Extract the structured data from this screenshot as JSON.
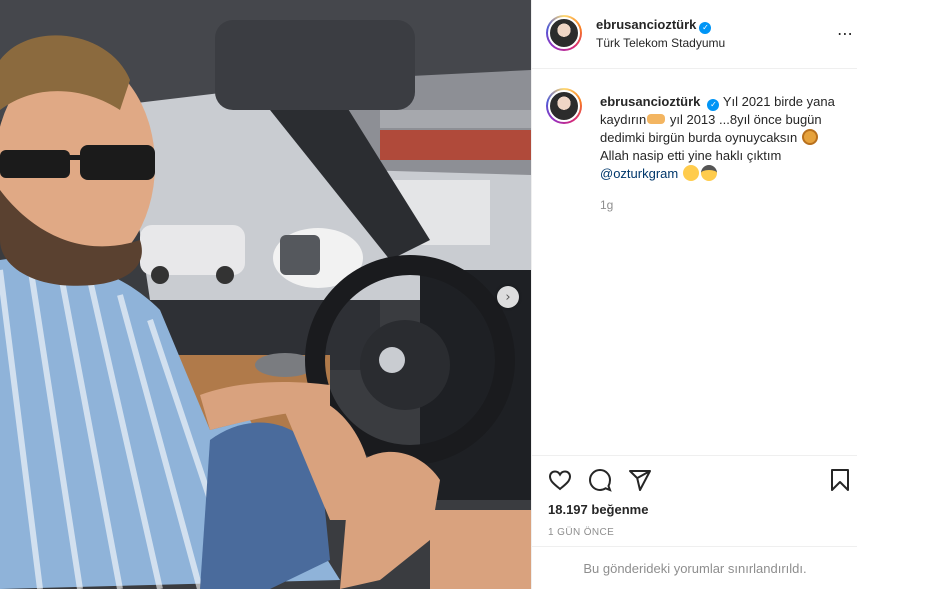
{
  "post": {
    "username": "ebrusancioztürk",
    "location": "Türk Telekom Stadyumu",
    "caption": {
      "username": "ebrusancioztürk",
      "line1": "Yıl 2021 birde yana kaydırın",
      "line2": " yıl 2013 ...8yıl önce bugün dedimki birgün burda oynuycaksın",
      "line3": " Allah nasip etti yine haklı çıktım",
      "mention": "@ozturkgram"
    },
    "time_ago": "1g",
    "likes": "18.197 beğenme",
    "date": "1 GÜN ÖNCE",
    "comments_notice": "Bu gönderideki yorumlar sınırlandırıldı."
  },
  "icons": {
    "more": "⋯",
    "verified": "✓",
    "carousel_next": "›"
  }
}
